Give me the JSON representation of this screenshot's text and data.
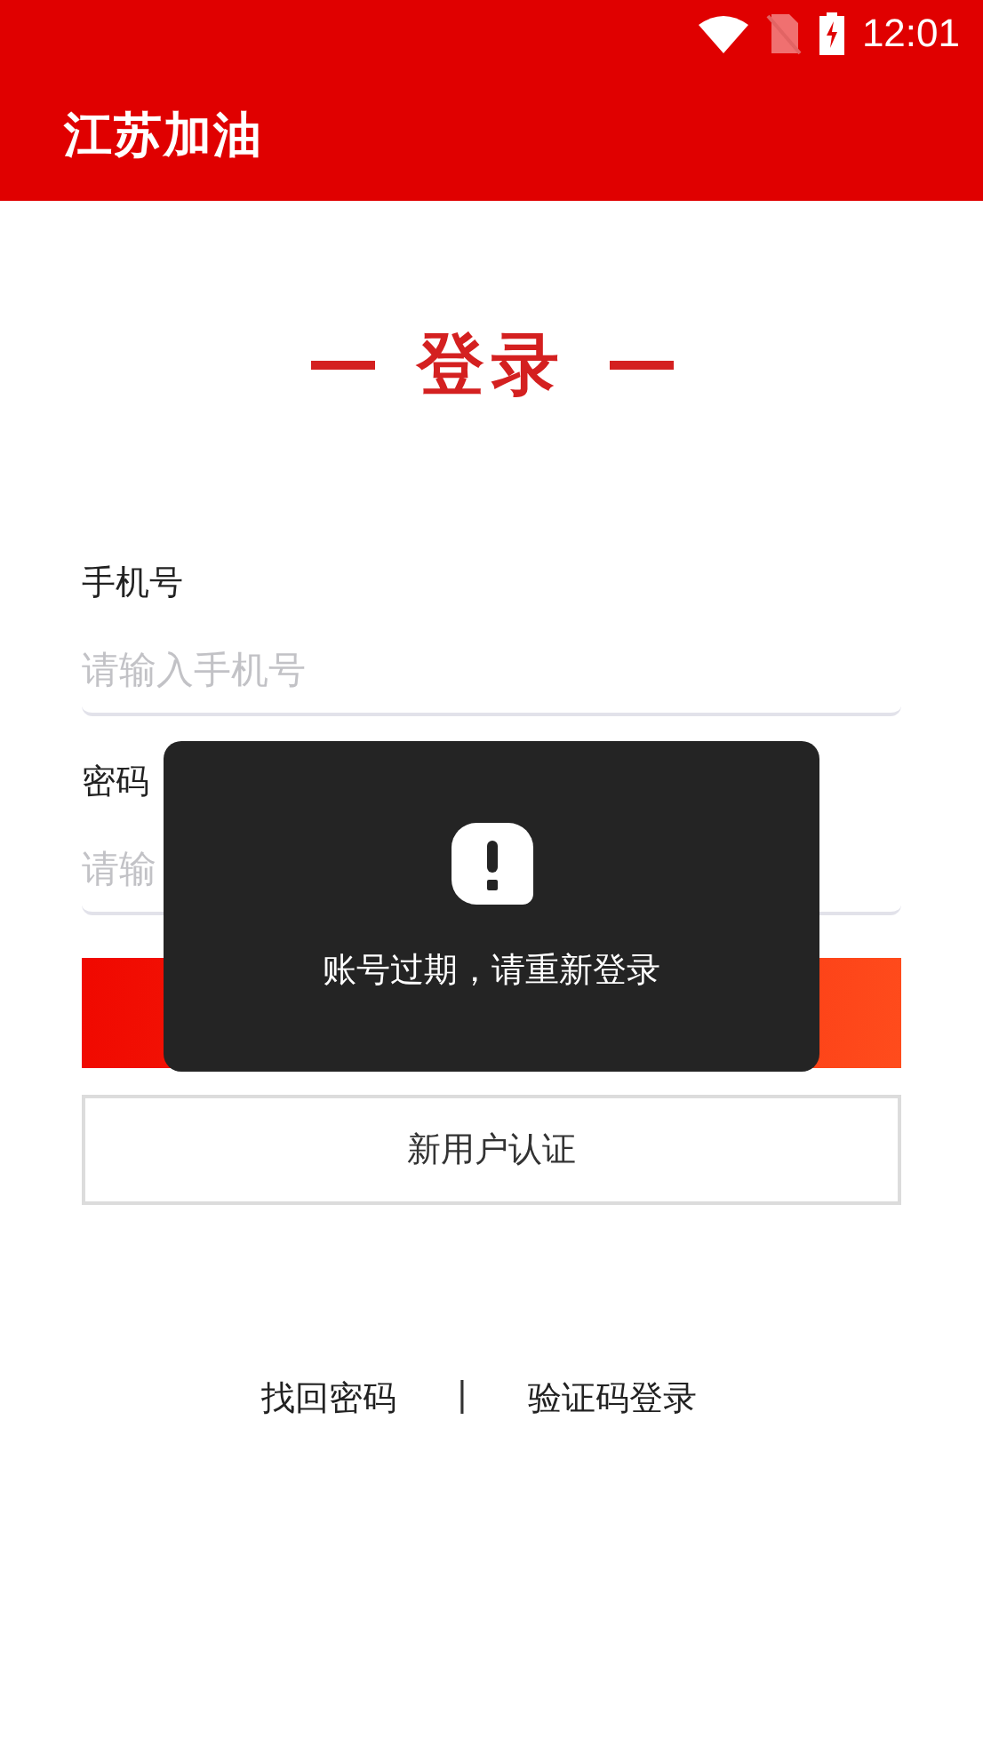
{
  "status_bar": {
    "time": "12:01"
  },
  "app_bar": {
    "title": "江苏加油"
  },
  "heading": "登录",
  "fields": [
    {
      "label": "手机号",
      "placeholder": "请输入手机号"
    },
    {
      "label": "密码",
      "placeholder": "请输"
    }
  ],
  "buttons": [
    {
      "kind": "primary"
    },
    {
      "kind": "outline",
      "label": "新用户认证"
    }
  ],
  "links": [
    "找回密码",
    "|",
    "验证码登录"
  ],
  "toast": {
    "message": "账号过期，请重新登录"
  }
}
